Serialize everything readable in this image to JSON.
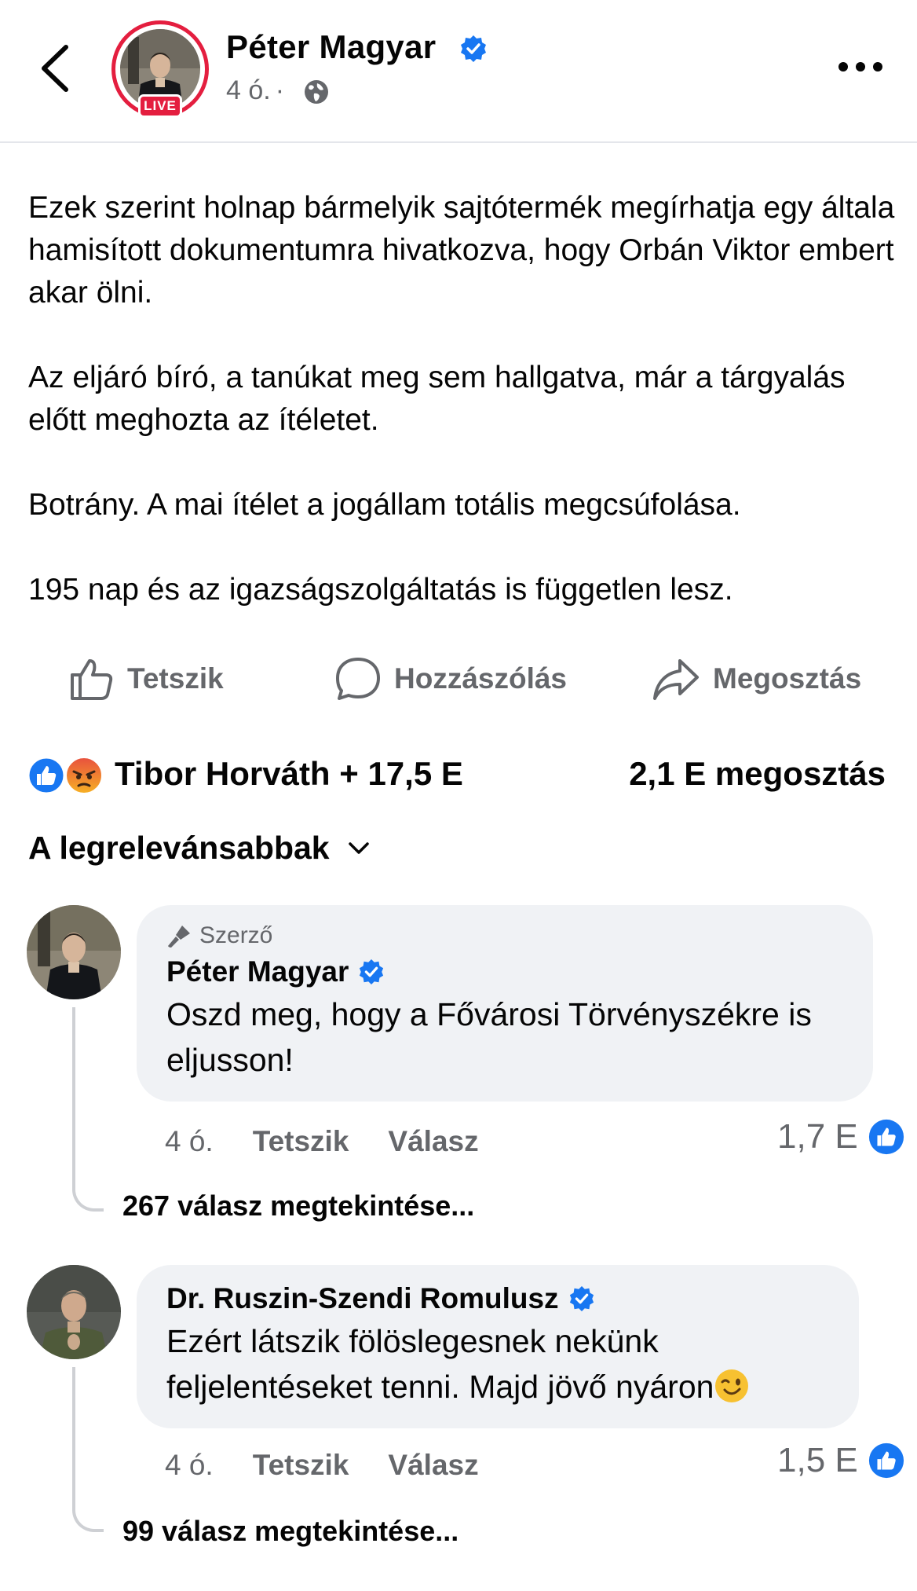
{
  "header": {
    "author_name": "Péter Magyar",
    "live_label": "LIVE",
    "time": "4 ó.",
    "separator": "·",
    "icons": [
      "back-arrow-icon",
      "verified-badge-icon",
      "globe-icon",
      "more-options-icon"
    ]
  },
  "post": {
    "paragraphs": [
      "Ezek szerint holnap bármelyik sajtótermék megírhatja egy általa hamisított dokumentumra hivatkozva, hogy Orbán Viktor embert akar ölni.",
      "Az eljáró bíró, a tanúkat meg sem hallgatva, már a tárgyalás előtt meghozta az ítéletet.",
      "Botrány. A mai ítélet a jogállam totális megcsúfolása.",
      "195 nap és az igazságszolgáltatás is független lesz."
    ]
  },
  "actions": {
    "like_label": "Tetszik",
    "comment_label": "Hozzászólás",
    "share_label": "Megosztás"
  },
  "reactions": {
    "summary": "Tibor Horváth + 17,5 E",
    "shares": "2,1 E megosztás",
    "types": [
      "like",
      "angry"
    ]
  },
  "sort": {
    "label": "A legrelevánsabbak"
  },
  "comments": [
    {
      "author_tag": "Szerző",
      "name": "Péter Magyar",
      "verified": true,
      "text": "Oszd meg, hogy a Fővárosi Törvényszékre is eljusson!",
      "time": "4 ó.",
      "like_label": "Tetszik",
      "reply_label": "Válasz",
      "reaction_count": "1,7 E",
      "view_replies": "267 válasz megtekintése..."
    },
    {
      "name": "Dr. Ruszin-Szendi Romulusz",
      "verified": true,
      "text_line1": "Ezért látszik fölöslegesnek nekünk",
      "text_line2": "feljelentéseket tenni. Majd jövő nyáron",
      "emoji": "winking-face",
      "time": "4 ó.",
      "like_label": "Tetszik",
      "reply_label": "Válasz",
      "reaction_count": "1,5 E",
      "view_replies": "99 válasz megtekintése..."
    }
  ],
  "colors": {
    "facebook_blue": "#1877f2",
    "live_red": "#e41e3f",
    "secondary_text": "#65676b",
    "bubble_bg": "#f0f2f5"
  }
}
